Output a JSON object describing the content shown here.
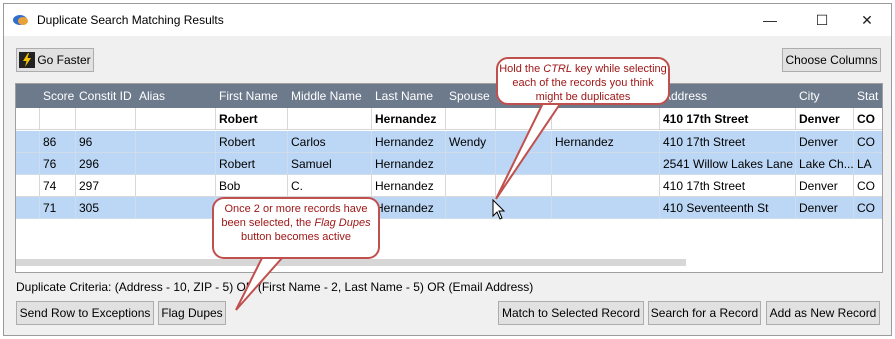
{
  "window": {
    "title": "Duplicate Search Matching Results",
    "controls": {
      "minimize": "—",
      "maximize": "☐",
      "close": "✕"
    }
  },
  "toolbar": {
    "go_faster_label": "Go Faster",
    "choose_columns_label": "Choose Columns"
  },
  "grid": {
    "columns": [
      "",
      "Score",
      "Constit ID",
      "Alias",
      "First Name",
      "Middle Name",
      "Last Name",
      "Spouse",
      "",
      "",
      "Address",
      "City",
      "Stat"
    ],
    "criteria_row": [
      "",
      "",
      "",
      "",
      "Robert",
      "",
      "Hernandez",
      "",
      "",
      "",
      "410 17th Street",
      "Denver",
      "CO"
    ],
    "rows": [
      [
        "",
        "86",
        "96",
        "",
        "Robert",
        "Carlos",
        "Hernandez",
        "Wendy",
        "",
        "Hernandez",
        "410 17th Street",
        "Denver",
        "CO"
      ],
      [
        "",
        "76",
        "296",
        "",
        "Robert",
        "Samuel",
        "Hernandez",
        "",
        "",
        "",
        "2541 Willow Lakes Lane",
        "Lake Ch...",
        "LA"
      ],
      [
        "",
        "74",
        "297",
        "",
        "Bob",
        "C.",
        "Hernandez",
        "",
        "",
        "",
        "410 17th Street",
        "Denver",
        "CO"
      ],
      [
        "",
        "71",
        "305",
        "",
        "",
        "",
        "Hernandez",
        "",
        "",
        "",
        "410 Seventeenth St",
        "Denver",
        "CO"
      ]
    ]
  },
  "criteria_text": "Duplicate Criteria: (Address - 10, ZIP - 5) OR (First Name - 2, Last Name - 5) OR (Email Address)",
  "buttons": {
    "send_row_label": "Send Row to Exceptions",
    "flag_dupes_label": "Flag Dupes",
    "match_selected_label": "Match to Selected Record",
    "search_record_label": "Search for a Record",
    "add_new_label": "Add as New Record"
  },
  "callouts": {
    "ctrl": {
      "pre": "Hold the ",
      "em": "CTRL",
      "post": " key while selecting each of the records you think might be duplicates"
    },
    "flag": {
      "pre": "Once 2 or more records have been selected, the ",
      "em": "Flag Dupes",
      "post": " button becomes active"
    }
  },
  "colors": {
    "header_bg": "#6d7a8c",
    "selected_row": "#bcd7f5",
    "callout_border": "#c0504d",
    "callout_text": "#a01818"
  }
}
